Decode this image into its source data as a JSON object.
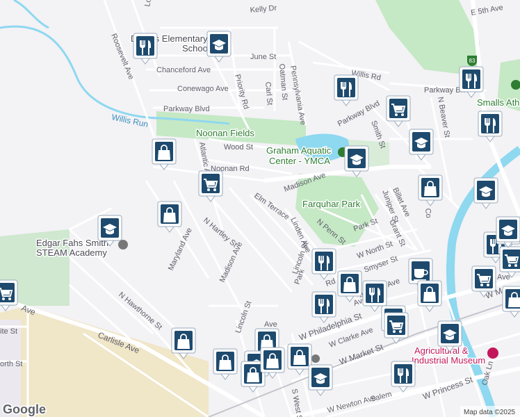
{
  "map": {
    "streets": [
      {
        "text": "Kelly Dr"
      },
      {
        "text": "E 5th Ave"
      },
      {
        "text": "Roosevelt Ave"
      },
      {
        "text": "June St"
      },
      {
        "text": "Chanceford Ave"
      },
      {
        "text": "Conewago Ave"
      },
      {
        "text": "Priority Rd"
      },
      {
        "text": "Carl St"
      },
      {
        "text": "Oatman St"
      },
      {
        "text": "Pennsylvania Ave"
      },
      {
        "text": "Willis Rd"
      },
      {
        "text": "Parkway Blvd"
      },
      {
        "text": "Parkway Blvd"
      },
      {
        "text": "Parkway Blvd"
      },
      {
        "text": "N Beaver St"
      },
      {
        "text": "Smith St"
      },
      {
        "text": "Wood St"
      },
      {
        "text": "Noonan Rd"
      },
      {
        "text": "Atlantic Ave"
      },
      {
        "text": "Madison Ave"
      },
      {
        "text": "Elm Terrace"
      },
      {
        "text": "Billet Ave"
      },
      {
        "text": "Juniper St"
      },
      {
        "text": "N Hartley St"
      },
      {
        "text": "Linden Ave"
      },
      {
        "text": "N Penn St"
      },
      {
        "text": "Park St"
      },
      {
        "text": "Grant St"
      },
      {
        "text": "Maryland Ave"
      },
      {
        "text": "Madison Ave"
      },
      {
        "text": "Lincoln St"
      },
      {
        "text": "W North St"
      },
      {
        "text": "Smyser St"
      },
      {
        "text": "Rd"
      },
      {
        "text": "Ave"
      },
      {
        "text": "N Hawthorne St"
      },
      {
        "text": "W Philadelphia St"
      },
      {
        "text": "Carlisle Ave"
      },
      {
        "text": "Lincoln St"
      },
      {
        "text": "W Clarke Ave"
      },
      {
        "text": "W Market St"
      },
      {
        "text": "W Princess St"
      },
      {
        "text": "S West St"
      },
      {
        "text": "W Newton Ave"
      },
      {
        "text": "Oak Ln"
      },
      {
        "text": "Salem"
      },
      {
        "text": "Park"
      },
      {
        "text": "Ave"
      },
      {
        "text": "ite St"
      },
      {
        "text": "orth St"
      },
      {
        "text": "Co"
      },
      {
        "text": "Fr"
      },
      {
        "text": "Louc"
      },
      {
        "text": "W M"
      },
      {
        "text": "Ave"
      },
      {
        "text": "Ave"
      },
      {
        "text": "ay Ave"
      },
      {
        "text": "as Ave"
      }
    ],
    "pois": [
      {
        "text": "Noonan Fields"
      },
      {
        "text": "Graham Aquatic"
      },
      {
        "text": "Center - YMCA"
      },
      {
        "text": "Farquhar Park"
      },
      {
        "text": "Edgar Fahs Smith"
      },
      {
        "text": "STEAM Academy"
      },
      {
        "text": "Agricultural &"
      },
      {
        "text": "Industrial Museum"
      },
      {
        "text": "Devers Elementary"
      },
      {
        "text": "School"
      },
      {
        "text": "Smalls Ath"
      }
    ],
    "highway_shield": "83",
    "water_label": "Willis Run",
    "markers": [
      {
        "icon": "restaurant-icon"
      },
      {
        "icon": "school-icon"
      },
      {
        "icon": "restaurant-icon"
      },
      {
        "icon": "grocery-cart-icon"
      },
      {
        "icon": "restaurant-icon"
      },
      {
        "icon": "shopping-bag-icon"
      },
      {
        "icon": "school-icon"
      },
      {
        "icon": "school-icon"
      },
      {
        "icon": "grocery-cart-icon"
      },
      {
        "icon": "restaurant-icon"
      },
      {
        "icon": "shopping-bag-icon"
      },
      {
        "icon": "school-icon"
      },
      {
        "icon": "shopping-bag-icon"
      },
      {
        "icon": "school-icon"
      },
      {
        "icon": "restaurant-icon"
      },
      {
        "icon": "grocery-cart-icon"
      },
      {
        "icon": "restaurant-icon"
      },
      {
        "icon": "shopping-bag-icon"
      },
      {
        "icon": "restaurant-icon"
      },
      {
        "icon": "coffee-icon"
      },
      {
        "icon": "grocery-cart-icon"
      },
      {
        "icon": "shopping-bag-icon"
      },
      {
        "icon": "restaurant-icon"
      },
      {
        "icon": "grocery-cart-icon"
      },
      {
        "icon": "grocery-cart-icon"
      },
      {
        "icon": "school-icon"
      },
      {
        "icon": "shopping-bag-icon"
      },
      {
        "icon": "shopping-bag-icon"
      },
      {
        "icon": "shopping-bag-icon"
      },
      {
        "icon": "shopping-bag-icon"
      },
      {
        "icon": "school-icon"
      },
      {
        "icon": "shopping-bag-icon"
      },
      {
        "icon": "shopping-bag-icon"
      },
      {
        "icon": "school-icon"
      },
      {
        "icon": "restaurant-icon"
      },
      {
        "icon": "grocery-cart-icon"
      },
      {
        "icon": "shopping-bag-icon"
      },
      {
        "icon": "grocery-cart-icon"
      },
      {
        "icon": "school-icon"
      }
    ]
  },
  "footer": {
    "logo": "Google",
    "attribution": "Map data ©2025"
  },
  "colors": {
    "background": "#f3f2f5",
    "park": "#c5e8c5",
    "water": "#8ed8f0",
    "road_major": "#ffffff",
    "sand": "#f0e6c8",
    "marker": "#1e4a6e"
  }
}
